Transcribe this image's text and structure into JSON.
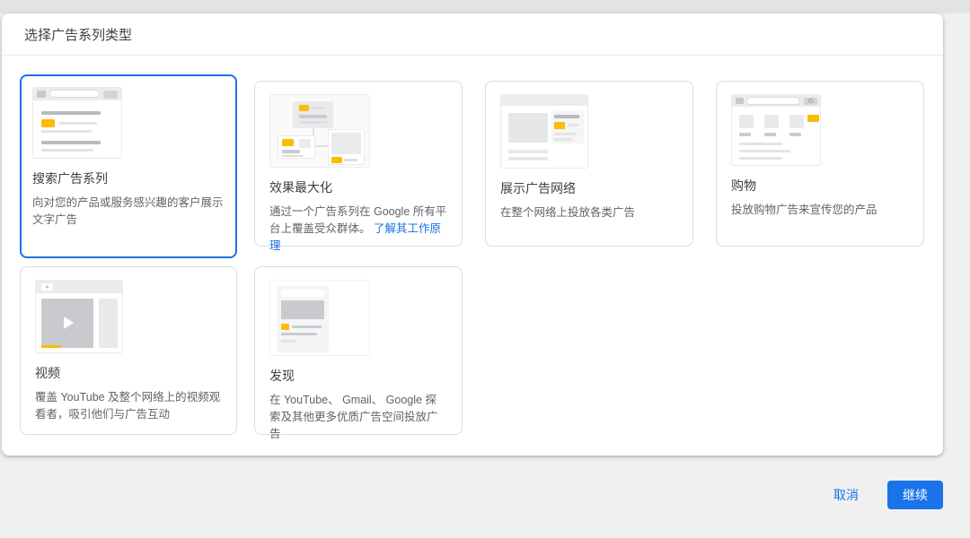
{
  "dialog": {
    "title": "选择广告系列类型",
    "cards": [
      {
        "title": "搜索广告系列",
        "description": "向对您的产品或服务感兴趣的客户展示文字广告",
        "selected": true
      },
      {
        "title": "效果最大化",
        "description": "通过一个广告系列在 Google 所有平台上覆盖受众群体。",
        "link": "了解其工作原理",
        "selected": false
      },
      {
        "title": "展示广告网络",
        "description": "在整个网络上投放各类广告",
        "selected": false
      },
      {
        "title": "购物",
        "description": "投放购物广告来宣传您的产品",
        "selected": false
      },
      {
        "title": "视频",
        "description": "覆盖 YouTube 及整个网络上的视频观看者，吸引他们与广告互动",
        "selected": false
      },
      {
        "title": "发现",
        "description": "在 YouTube、 Gmail、 Google 探索及其他更多优质广告空间投放广告",
        "selected": false
      }
    ]
  },
  "footer": {
    "cancel_label": "取消",
    "continue_label": "继续"
  },
  "colors": {
    "accent": "#1a73e8",
    "ad_badge_yellow": "#fbbc04"
  }
}
